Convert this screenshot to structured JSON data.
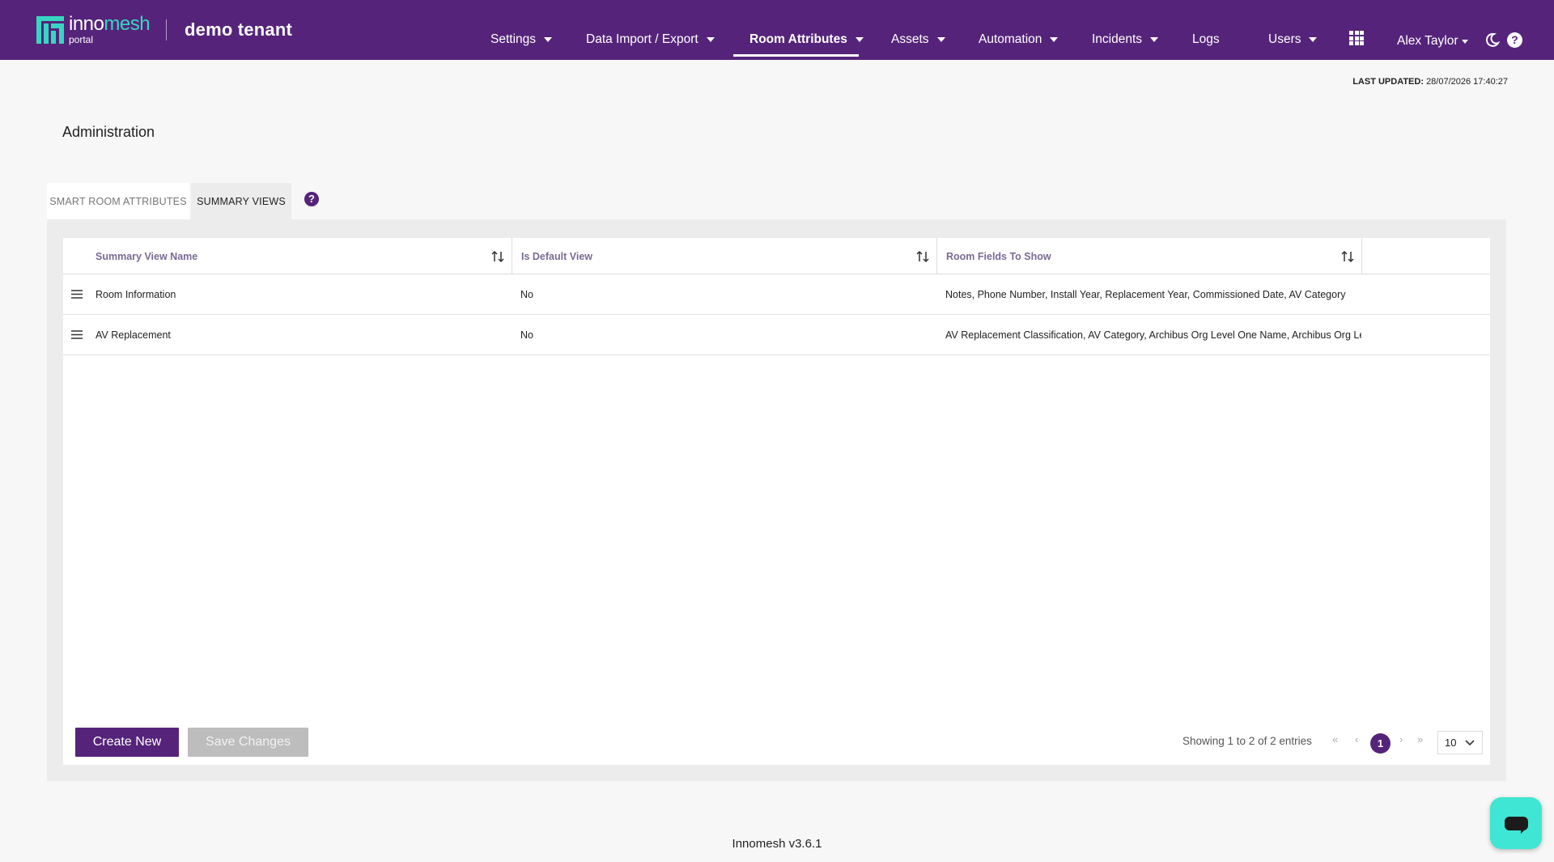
{
  "header": {
    "brand_left": "inno",
    "brand_right": "mesh",
    "brand_sub": "portal",
    "tenant": "demo tenant",
    "nav": [
      {
        "label": "Settings",
        "dropdown": true
      },
      {
        "label": "Data Import / Export",
        "dropdown": true
      },
      {
        "label": "Room Attributes",
        "dropdown": true,
        "active": true
      },
      {
        "label": "Assets",
        "dropdown": true
      },
      {
        "label": "Automation",
        "dropdown": true
      },
      {
        "label": "Incidents",
        "dropdown": true
      },
      {
        "label": "Logs",
        "dropdown": false
      },
      {
        "label": "Users",
        "dropdown": true
      }
    ],
    "user": "Alex Taylor",
    "icons": [
      "apps-grid-icon",
      "dark-mode-moon-icon",
      "help-icon"
    ],
    "help_glyph": "?"
  },
  "last_updated": {
    "label": "LAST UPDATED:",
    "value": "28/07/2026 17:40:27"
  },
  "page_title": "Administration",
  "tabs": [
    {
      "label": "Smart Room Attributes",
      "active": false
    },
    {
      "label": "Summary Views",
      "active": true
    }
  ],
  "tab_help_glyph": "?",
  "table": {
    "columns": [
      "Summary View Name",
      "Is Default View",
      "Room Fields To Show"
    ],
    "rows": [
      {
        "name": "Room Information",
        "is_default": "No",
        "fields": "Notes, Phone Number, Install Year, Replacement Year, Commissioned Date, AV Category"
      },
      {
        "name": "AV Replacement",
        "is_default": "No",
        "fields": "AV Replacement Classification, AV Category, Archibus Org Level One Name, Archibus Org Level Two Name"
      }
    ]
  },
  "actions": {
    "create": "Create New",
    "save": "Save Changes"
  },
  "pagination": {
    "summary": "Showing 1 to 2 of 2 entries",
    "first": "«",
    "prev": "‹",
    "current": "1",
    "next": "›",
    "last": "»",
    "page_size": "10"
  },
  "footer": {
    "version": "Innomesh v3.6.1"
  },
  "colors": {
    "brand_purple": "#55247a",
    "accent_teal": "#37d6c3",
    "chat_teal": "#3fe6d3"
  }
}
